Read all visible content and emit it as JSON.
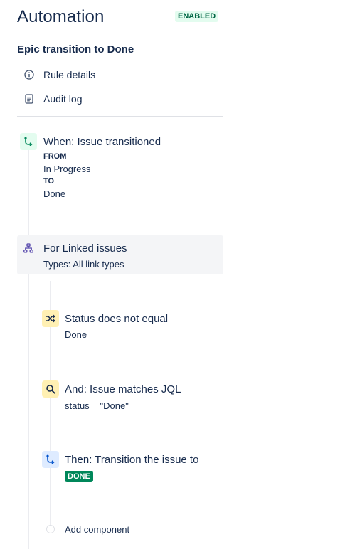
{
  "header": {
    "title": "Automation",
    "status_badge": "ENABLED"
  },
  "rule": {
    "name": "Epic transition to Done"
  },
  "sidebar": {
    "items": [
      {
        "label": "Rule details",
        "icon": "info-icon"
      },
      {
        "label": "Audit log",
        "icon": "document-icon"
      }
    ]
  },
  "trigger": {
    "title": "When: Issue transitioned",
    "from_label": "FROM",
    "from_value": "In Progress",
    "to_label": "TO",
    "to_value": "Done",
    "icon": "branch-arrow-icon"
  },
  "branch": {
    "title": "For Linked issues",
    "subtitle": "Types: All link types",
    "icon": "hierarchy-icon"
  },
  "conditions": [
    {
      "title": "Status does not equal",
      "subtitle": "Done",
      "icon": "shuffle-icon"
    },
    {
      "title": "And: Issue matches JQL",
      "subtitle": "status = \"Done\"",
      "icon": "search-icon"
    }
  ],
  "action": {
    "title": "Then: Transition the issue to",
    "status_lozenge": "DONE",
    "icon": "branch-arrow-icon"
  },
  "add_component": {
    "label": "Add component"
  },
  "colors": {
    "trigger_bg": "#e3fcef",
    "trigger_fg": "#00875a",
    "branch_bg": "#eae6ff",
    "branch_fg": "#5243aa",
    "condition_bg": "#fff0b3",
    "condition_fg": "#172b4d",
    "action_bg": "#deebff",
    "action_fg": "#0052cc",
    "done_green": "#00875a"
  }
}
